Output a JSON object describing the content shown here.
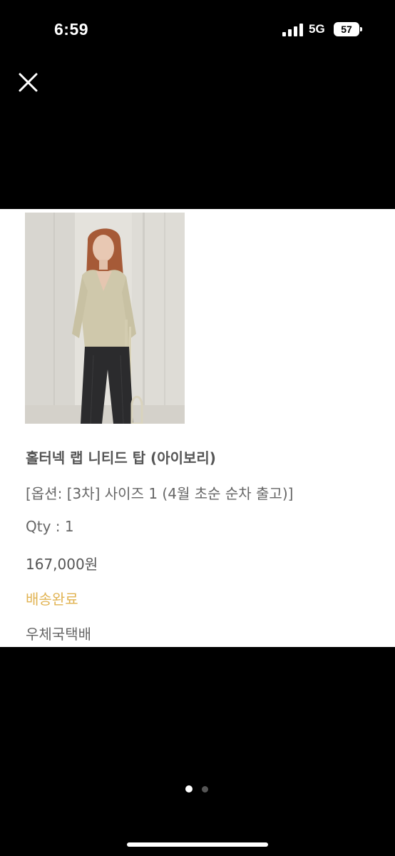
{
  "status_bar": {
    "time": "6:59",
    "network": "5G",
    "battery": "57",
    "signal_icon": "cellular-signal-icon",
    "battery_icon": "battery-icon"
  },
  "viewer": {
    "close_icon": "close-icon",
    "page_count": 2,
    "active_page": 1
  },
  "order_item": {
    "image_alt": "product-photo",
    "name": "홀터넥 랩 니티드 탑 (아이보리)",
    "option": "[옵션: [3차] 사이즈 1 (4월 초순 순차 출고)]",
    "quantity": "Qty : 1",
    "price": "167,000원",
    "delivery_status": "배송완료",
    "courier": "우체국택배"
  },
  "colors": {
    "background": "#000000",
    "panel": "#ffffff",
    "status_accent": "#e1b352"
  }
}
